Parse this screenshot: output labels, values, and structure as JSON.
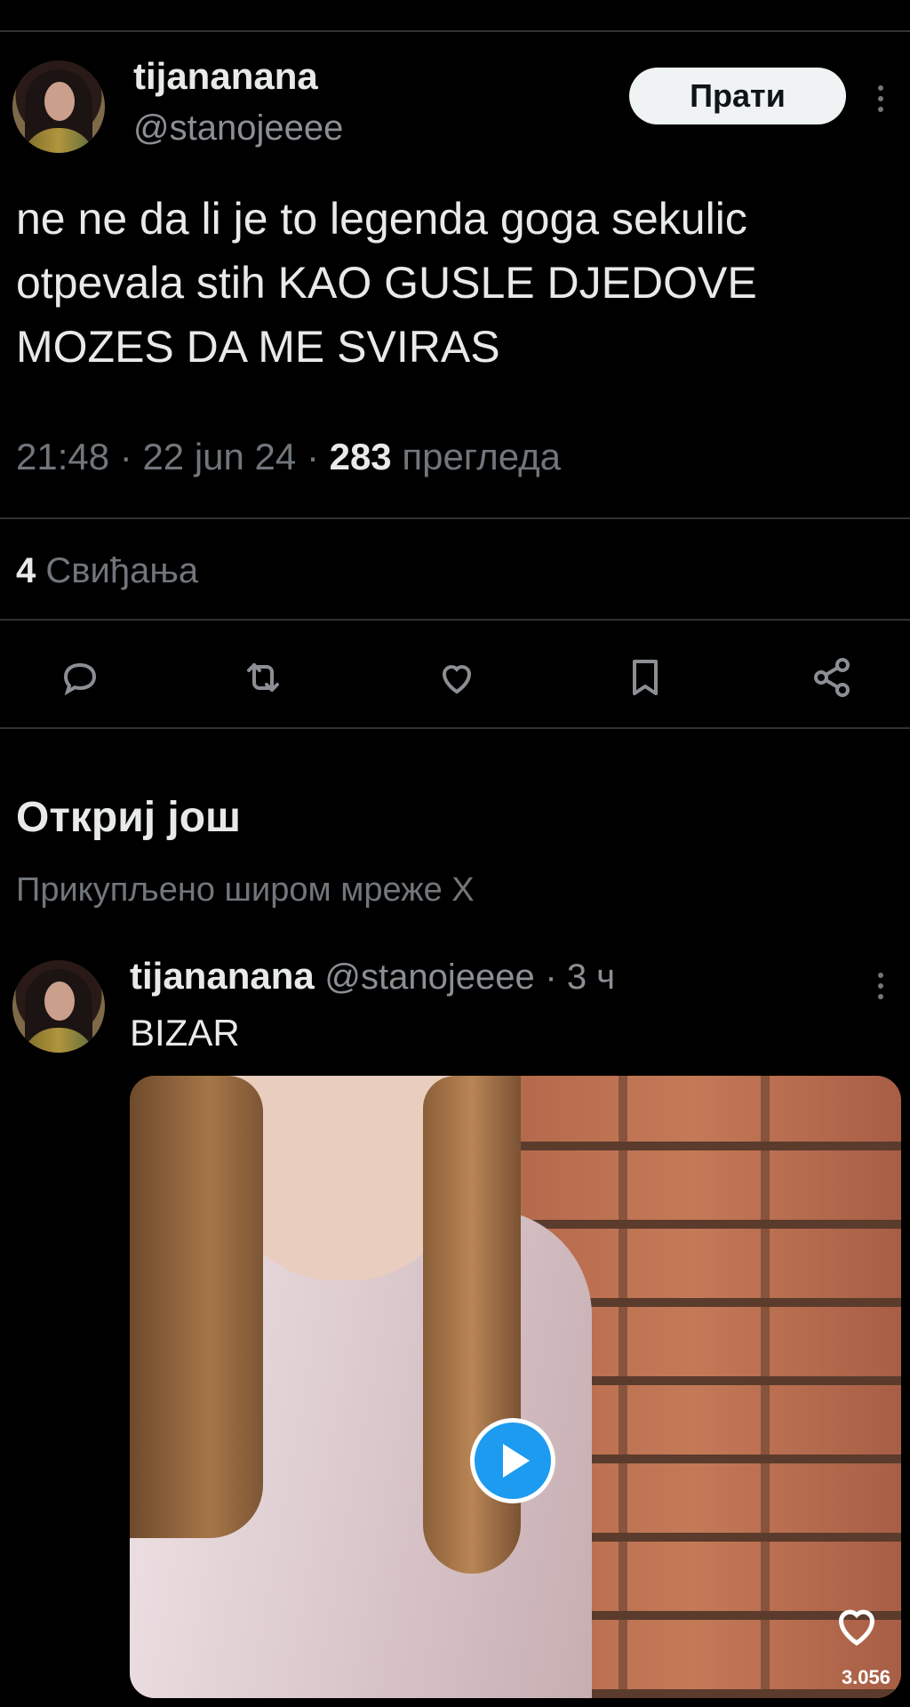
{
  "main_tweet": {
    "display_name": "tijananana",
    "handle": "@stanojeeee",
    "follow_label": "Прати",
    "text": "ne ne da li je to legenda goga sekulic otpevala stih KAO GUSLE DJEDOVE MOZES DA ME SVIRAS",
    "time": "21:48",
    "date": "22 jun 24",
    "views_count": "283",
    "views_label": "прегледа",
    "likes_count": "4",
    "likes_label": "Свиђања"
  },
  "actions": [
    "reply-icon",
    "retweet-icon",
    "like-icon",
    "bookmark-icon",
    "share-icon"
  ],
  "discover": {
    "title": "Откриј још",
    "subtitle": "Прикупљено широм мреже X"
  },
  "second_tweet": {
    "display_name": "tijananana",
    "handle": "@stanojeeee",
    "time_ago": "3 ч",
    "text": "BIZAR",
    "media_like_count": "3.056"
  },
  "colors": {
    "background": "#000000",
    "text": "#e7e9ea",
    "muted": "#71767b",
    "accent": "#1d9bf0",
    "divider": "#2f3336"
  }
}
